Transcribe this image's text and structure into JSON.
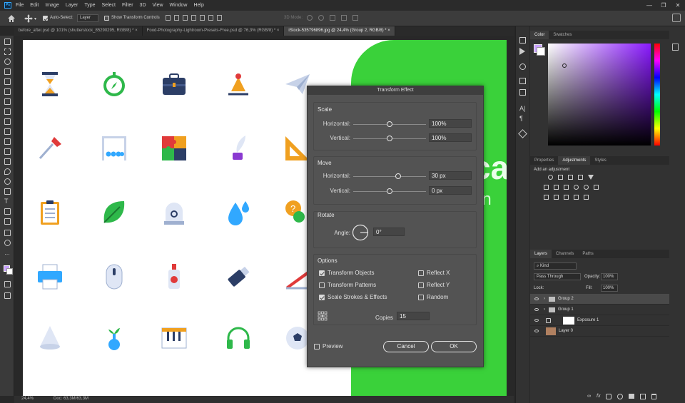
{
  "app": {
    "logo": "Ps",
    "menu": [
      "File",
      "Edit",
      "Image",
      "Layer",
      "Type",
      "Select",
      "Filter",
      "3D",
      "View",
      "Window",
      "Help"
    ],
    "window_controls": [
      "—",
      "❐",
      "✕"
    ]
  },
  "options_bar": {
    "auto_select_label": "Auto-Select:",
    "auto_select_value": "Layer",
    "transform_controls_label": "Show Transform Controls",
    "mode_3d_label": "3D Mode:"
  },
  "tabs": [
    {
      "label": "before_after.psd @ 101% (shutterstock_85290295, RGB/8) *",
      "close": "×"
    },
    {
      "label": "Food-Photography-Lightroom-Presets-Free.psd @ 76,3% (RGB/8) *",
      "close": "×"
    },
    {
      "label": "iStock-535796896.jpg @ 24,4% (Group 2, RGB/8) *",
      "close": "×"
    }
  ],
  "canvas": {
    "overlay_text_1": "ca",
    "overlay_text_2": "on"
  },
  "status_bar": {
    "zoom": "24,4%",
    "doc": "Doc: 63,3M/63,3M"
  },
  "dialog": {
    "title": "Transform Effect",
    "scale": {
      "title": "Scale",
      "horizontal_label": "Horizontal:",
      "horizontal_value": "100%",
      "horizontal_level": 0.5,
      "vertical_label": "Vertical:",
      "vertical_value": "100%",
      "vertical_level": 0.5
    },
    "move": {
      "title": "Move",
      "horizontal_label": "Horizontal:",
      "horizontal_value": "30 px",
      "horizontal_level": 0.62,
      "vertical_label": "Vertical:",
      "vertical_value": "0 px",
      "vertical_level": 0.5
    },
    "rotate": {
      "title": "Rotate",
      "angle_label": "Angle:",
      "angle_value": "0°"
    },
    "options": {
      "title": "Options",
      "transform_objects": {
        "label": "Transform Objects",
        "checked": true
      },
      "transform_patterns": {
        "label": "Transform Patterns",
        "checked": false
      },
      "scale_strokes": {
        "label": "Scale Strokes & Effects",
        "checked": true
      },
      "reflect_x": {
        "label": "Reflect X",
        "checked": false
      },
      "reflect_y": {
        "label": "Reflect Y",
        "checked": false
      },
      "random": {
        "label": "Random",
        "checked": false
      },
      "copies_label": "Copies",
      "copies_value": "15"
    },
    "preview_label": "Preview",
    "cancel_label": "Cancel",
    "ok_label": "OK"
  },
  "right_panel": {
    "color_tabs": [
      "Color",
      "Swatches"
    ],
    "props_tabs": [
      "Properties",
      "Adjustments",
      "Styles"
    ],
    "add_adjustment": "Add an adjustment",
    "layers_tabs": [
      "Layers",
      "Channels",
      "Paths"
    ],
    "kind_label": "Kind",
    "blend_mode": "Pass Through",
    "opacity_label": "Opacity:",
    "opacity_value": "100%",
    "lock_label": "Lock:",
    "fill_label": "Fill:",
    "fill_value": "100%",
    "layers": [
      {
        "name": "Group 2",
        "type": "group"
      },
      {
        "name": "Group 1",
        "type": "group"
      },
      {
        "name": "Exposure 1",
        "type": "adjustment"
      },
      {
        "name": "Layer 0",
        "type": "image"
      }
    ],
    "bottom_icons": [
      "link-icon",
      "fx-icon",
      "mask-icon",
      "adjustment-icon",
      "folder-icon",
      "new-layer-icon",
      "trash-icon"
    ]
  },
  "colors": {
    "accent": "#31a8ff",
    "canvas_green": "#3ad13a",
    "dialog_bg": "#535353"
  }
}
